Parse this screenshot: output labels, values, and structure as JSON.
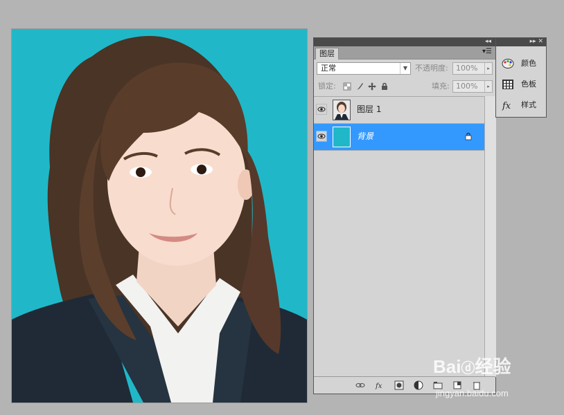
{
  "canvas": {
    "background_color": "#20b8c8"
  },
  "layers_panel": {
    "tab_label": "图层",
    "blend_mode": "正常",
    "opacity_label": "不透明度:",
    "opacity_value": "100%",
    "lock_label": "锁定:",
    "fill_label": "填充:",
    "fill_value": "100%",
    "layers": [
      {
        "name": "图层 1",
        "visible": true,
        "selected": false,
        "thumb": "portrait"
      },
      {
        "name": "背景",
        "visible": true,
        "selected": true,
        "locked": true,
        "thumb": "cyan-fill"
      }
    ],
    "bottom_icons": [
      "link-icon",
      "fx-icon",
      "mask-icon",
      "adjustment-icon",
      "group-icon",
      "new-layer-icon",
      "trash-icon"
    ]
  },
  "side_panel": {
    "items": [
      {
        "label": "颜色",
        "icon": "palette-icon"
      },
      {
        "label": "色板",
        "icon": "swatches-icon"
      },
      {
        "label": "样式",
        "icon": "fx-style-icon"
      }
    ]
  },
  "watermark": {
    "brand": "Bai",
    "brand2": "经验",
    "url": "jingyan.baidu.com"
  },
  "colors": {
    "selection": "#3399ff",
    "panel": "#d4d4d4",
    "workspace": "#b4b4b4"
  }
}
